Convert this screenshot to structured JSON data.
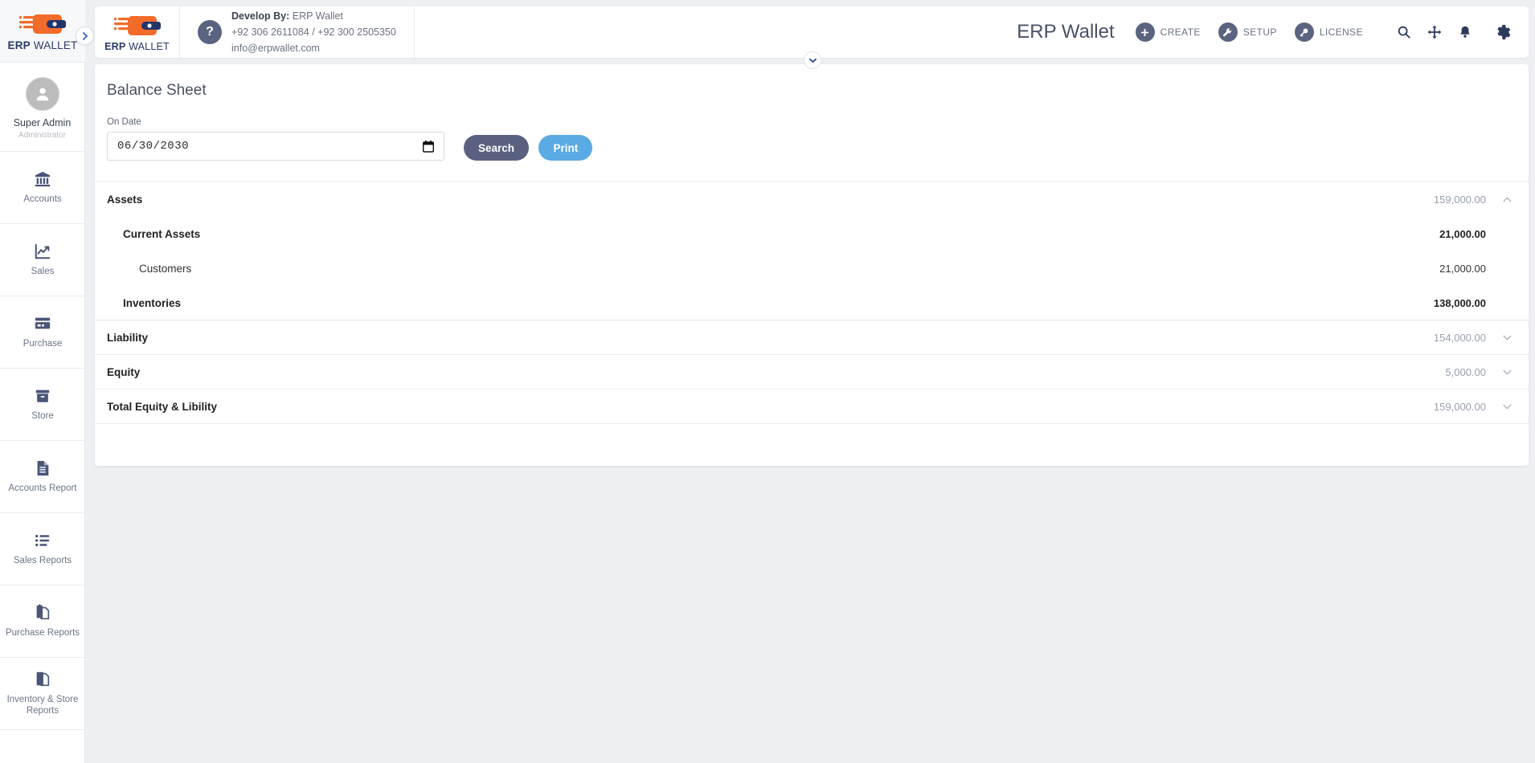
{
  "sidebar": {
    "logo_text_bold": "ERP",
    "logo_text_light": " WALLET",
    "toggle_icon": "chevron-right-icon",
    "user": {
      "name": "Super Admin",
      "role": "Administrator",
      "avatar_icon": "user-avatar-icon"
    },
    "items": [
      {
        "label": "Accounts",
        "icon": "bank-icon"
      },
      {
        "label": "Sales",
        "icon": "line-chart-icon"
      },
      {
        "label": "Purchase",
        "icon": "credit-card-icon"
      },
      {
        "label": "Store",
        "icon": "box-icon"
      },
      {
        "label": "Accounts Report",
        "icon": "document-lines-icon"
      },
      {
        "label": "Sales Reports",
        "icon": "list-icon"
      },
      {
        "label": "Purchase Reports",
        "icon": "copy-documents-icon"
      },
      {
        "label": "Inventory & Store Reports",
        "icon": "documents-stack-icon"
      }
    ]
  },
  "topbar": {
    "logo_text_bold": "ERP",
    "logo_text_light": " WALLET",
    "help_icon": "question-mark-icon",
    "develop_by_label": "Develop By:",
    "develop_by_value": "ERP Wallet",
    "phone": "+92 306 2611084 / +92 300 2505350",
    "email": "info@erpwallet.com",
    "brand_title": "ERP Wallet",
    "actions": [
      {
        "label": "CREATE",
        "icon": "plus-icon"
      },
      {
        "label": "SETUP",
        "icon": "wrench-icon"
      },
      {
        "label": "LICENSE",
        "icon": "key-icon"
      }
    ],
    "icons": [
      {
        "name": "search-icon"
      },
      {
        "name": "move-arrows-icon"
      },
      {
        "name": "bell-icon"
      },
      {
        "name": "gear-icon"
      }
    ],
    "collapse_icon": "chevron-down-icon"
  },
  "main": {
    "page_title": "Balance Sheet",
    "filter": {
      "date_label": "On Date",
      "date_value": "06/30/2030",
      "calendar_icon": "calendar-icon",
      "search_label": "Search",
      "print_label": "Print"
    },
    "rows": [
      {
        "label": "Assets",
        "amount": "159,000.00",
        "level": 0,
        "style": "muted",
        "chevron": "chevron-up-icon",
        "border": "none"
      },
      {
        "label": "Current Assets",
        "amount": "21,000.00",
        "level": 1,
        "style": "strong",
        "chevron": "",
        "border": "none"
      },
      {
        "label": "Customers",
        "amount": "21,000.00",
        "level": 2,
        "style": "plain",
        "chevron": "",
        "border": "none"
      },
      {
        "label": "Inventories",
        "amount": "138,000.00",
        "level": 1,
        "style": "strong",
        "chevron": "",
        "border": "group"
      },
      {
        "label": "Liability",
        "amount": "154,000.00",
        "level": 0,
        "style": "muted",
        "chevron": "chevron-down-icon",
        "border": "row"
      },
      {
        "label": "Equity",
        "amount": "5,000.00",
        "level": 0,
        "style": "muted",
        "chevron": "chevron-down-icon",
        "border": "row"
      },
      {
        "label": "Total Equity & Libility",
        "amount": "159,000.00",
        "level": 0,
        "style": "muted",
        "chevron": "chevron-down-icon",
        "border": "row"
      }
    ]
  },
  "colors": {
    "accent_orange": "#F26B2A",
    "brand_navy": "#23366B",
    "search_button": "#5A6080",
    "print_button": "#5AAAE4",
    "page_background": "#EEF0F4"
  }
}
